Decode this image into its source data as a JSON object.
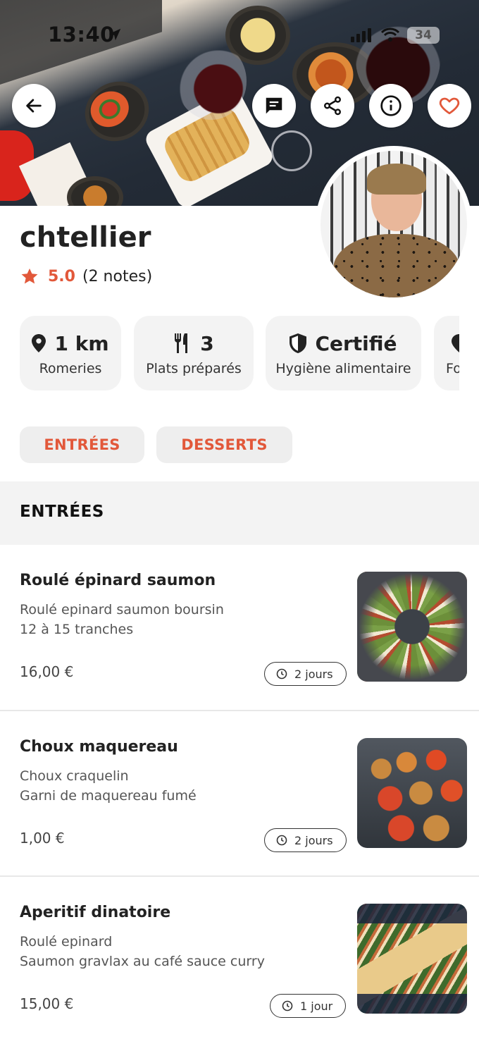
{
  "status_bar": {
    "time": "13:40",
    "battery": "34"
  },
  "header_actions": [
    "back-icon",
    "chat-icon",
    "share-icon",
    "info-icon",
    "heart-icon"
  ],
  "profile": {
    "name": "chtellier",
    "rating": "5.0",
    "rating_count": "(2 notes)"
  },
  "stats": [
    {
      "icon": "location-pin-icon",
      "value": "1 km",
      "label": "Romeries"
    },
    {
      "icon": "cutlery-icon",
      "value": "3",
      "label": "Plats préparés"
    },
    {
      "icon": "shield-icon",
      "value": "Certifié",
      "label": "Hygiène alimentaire"
    },
    {
      "icon": "partial-icon",
      "value": "",
      "label": "Fo"
    }
  ],
  "categories": [
    "ENTRÉES",
    "DESSERTS"
  ],
  "section_title": "ENTRÉES",
  "dishes": [
    {
      "title": "Roulé épinard saumon",
      "desc_line1": "Roulé epinard saumon boursin",
      "desc_line2": "12 à 15 tranches",
      "price": "16,00 €",
      "delay": "2 jours"
    },
    {
      "title": "Choux maquereau",
      "desc_line1": "Choux craquelin",
      "desc_line2": "Garni de maquereau fumé",
      "price": "1,00 €",
      "delay": "2 jours"
    },
    {
      "title": "Aperitif dinatoire",
      "desc_line1": "Roulé epinard",
      "desc_line2": "Saumon gravlax au café sauce curry",
      "price": "15,00 €",
      "delay": "1 jour"
    }
  ],
  "colors": {
    "accent": "#e2583a",
    "card_bg": "#f3f3f3",
    "text": "#222222"
  }
}
